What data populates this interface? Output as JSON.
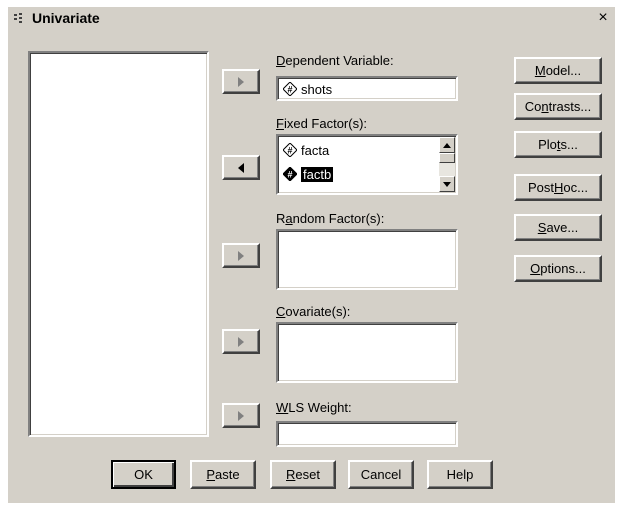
{
  "window": {
    "title": "Univariate",
    "close_label": "×"
  },
  "labels": {
    "dependent_variable": {
      "pre": "",
      "key": "D",
      "post": "ependent Variable:"
    },
    "fixed_factors": {
      "pre": "",
      "key": "F",
      "post": "ixed Factor(s):"
    },
    "random_factors": {
      "pre": "R",
      "key": "a",
      "post": "ndom Factor(s):"
    },
    "covariates": {
      "pre": "",
      "key": "C",
      "post": "ovariate(s):"
    },
    "wls_weight": {
      "pre": "",
      "key": "W",
      "post": "LS Weight:"
    }
  },
  "dependent_variable": {
    "value": "shots",
    "icon": "numeric-variable-icon"
  },
  "fixed_factors": [
    {
      "name": "facta",
      "icon": "numeric-variable-icon",
      "selected": false
    },
    {
      "name": "factb",
      "icon": "numeric-variable-icon",
      "selected": true
    }
  ],
  "side_buttons": {
    "model": {
      "pre": "",
      "key": "M",
      "post": "odel..."
    },
    "contrasts": {
      "pre": "Co",
      "key": "n",
      "post": "trasts..."
    },
    "plots": {
      "pre": "Plo",
      "key": "t",
      "post": "s..."
    },
    "post_hoc": {
      "pre": "Post ",
      "key": "H",
      "post": "oc..."
    },
    "save": {
      "pre": "",
      "key": "S",
      "post": "ave..."
    },
    "options": {
      "pre": "",
      "key": "O",
      "post": "ptions..."
    }
  },
  "bottom_buttons": {
    "ok": {
      "pre": "OK",
      "key": "",
      "post": ""
    },
    "paste": {
      "pre": "",
      "key": "P",
      "post": "aste"
    },
    "reset": {
      "pre": "",
      "key": "R",
      "post": "eset"
    },
    "cancel": {
      "pre": "Cancel",
      "key": "",
      "post": ""
    },
    "help": {
      "pre": "Help",
      "key": "",
      "post": ""
    }
  },
  "colors": {
    "dialog_bg": "#d4d0c8",
    "selection_bg": "#000000",
    "field_bg": "#ffffff"
  }
}
